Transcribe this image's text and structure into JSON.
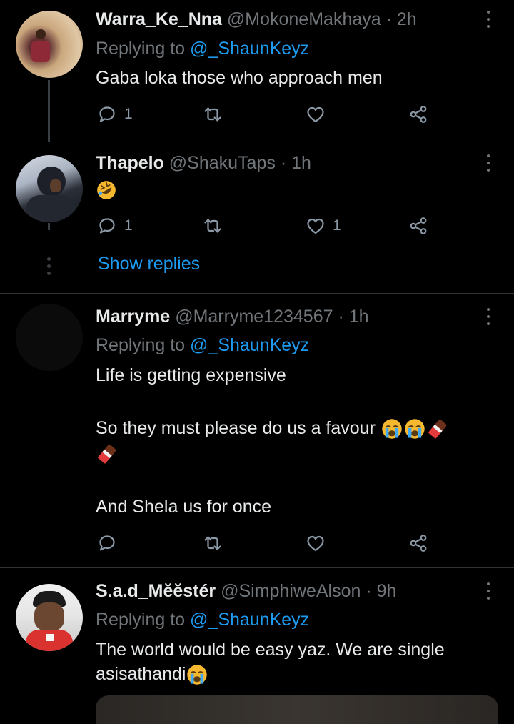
{
  "tweets": [
    {
      "name": "Warra_Ke_Nna",
      "meta": "@MokoneMakhaya · 2h",
      "replying_prefix": "Replying to",
      "replying_handle": "@_ShaunKeyz",
      "text": "Gaba loka those who approach men",
      "reply_count": "1",
      "retweet_count": "",
      "like_count": ""
    },
    {
      "name": "Thapelo",
      "meta": "@ShakuTaps · 1h",
      "reply_count": "1",
      "retweet_count": "",
      "like_count": "1",
      "emoji": "rolling-on-floor-laughing"
    },
    {
      "show_replies": "Show replies"
    },
    {
      "name": "Marryme",
      "meta": "@Marryme1234567 · 1h",
      "replying_prefix": "Replying to",
      "replying_handle": "@_ShaunKeyz",
      "line1": "Life is getting expensive",
      "line2": "So they must please do us a favour",
      "line3": "And Shela us for once",
      "emojis": [
        "loudly-crying-face",
        "loudly-crying-face",
        "chocolate-bar",
        "chocolate-bar"
      ]
    },
    {
      "name": "S.a.d_Mĕĕstér",
      "meta": "@SimphiweAlson · 9h",
      "replying_prefix": "Replying to",
      "replying_handle": "@_ShaunKeyz",
      "line1": "The world would be easy yaz. We are single",
      "line2": "asisathandi",
      "emojis": [
        "loudly-crying-face"
      ]
    }
  ],
  "icons": {
    "reply": "reply-icon",
    "retweet": "retweet-icon",
    "like": "heart-icon",
    "share": "share-icon",
    "more": "more-options-icon"
  },
  "colors": {
    "background": "#000000",
    "link": "#1d9bf0",
    "muted": "#71767b",
    "text": "#e7e9ea"
  }
}
